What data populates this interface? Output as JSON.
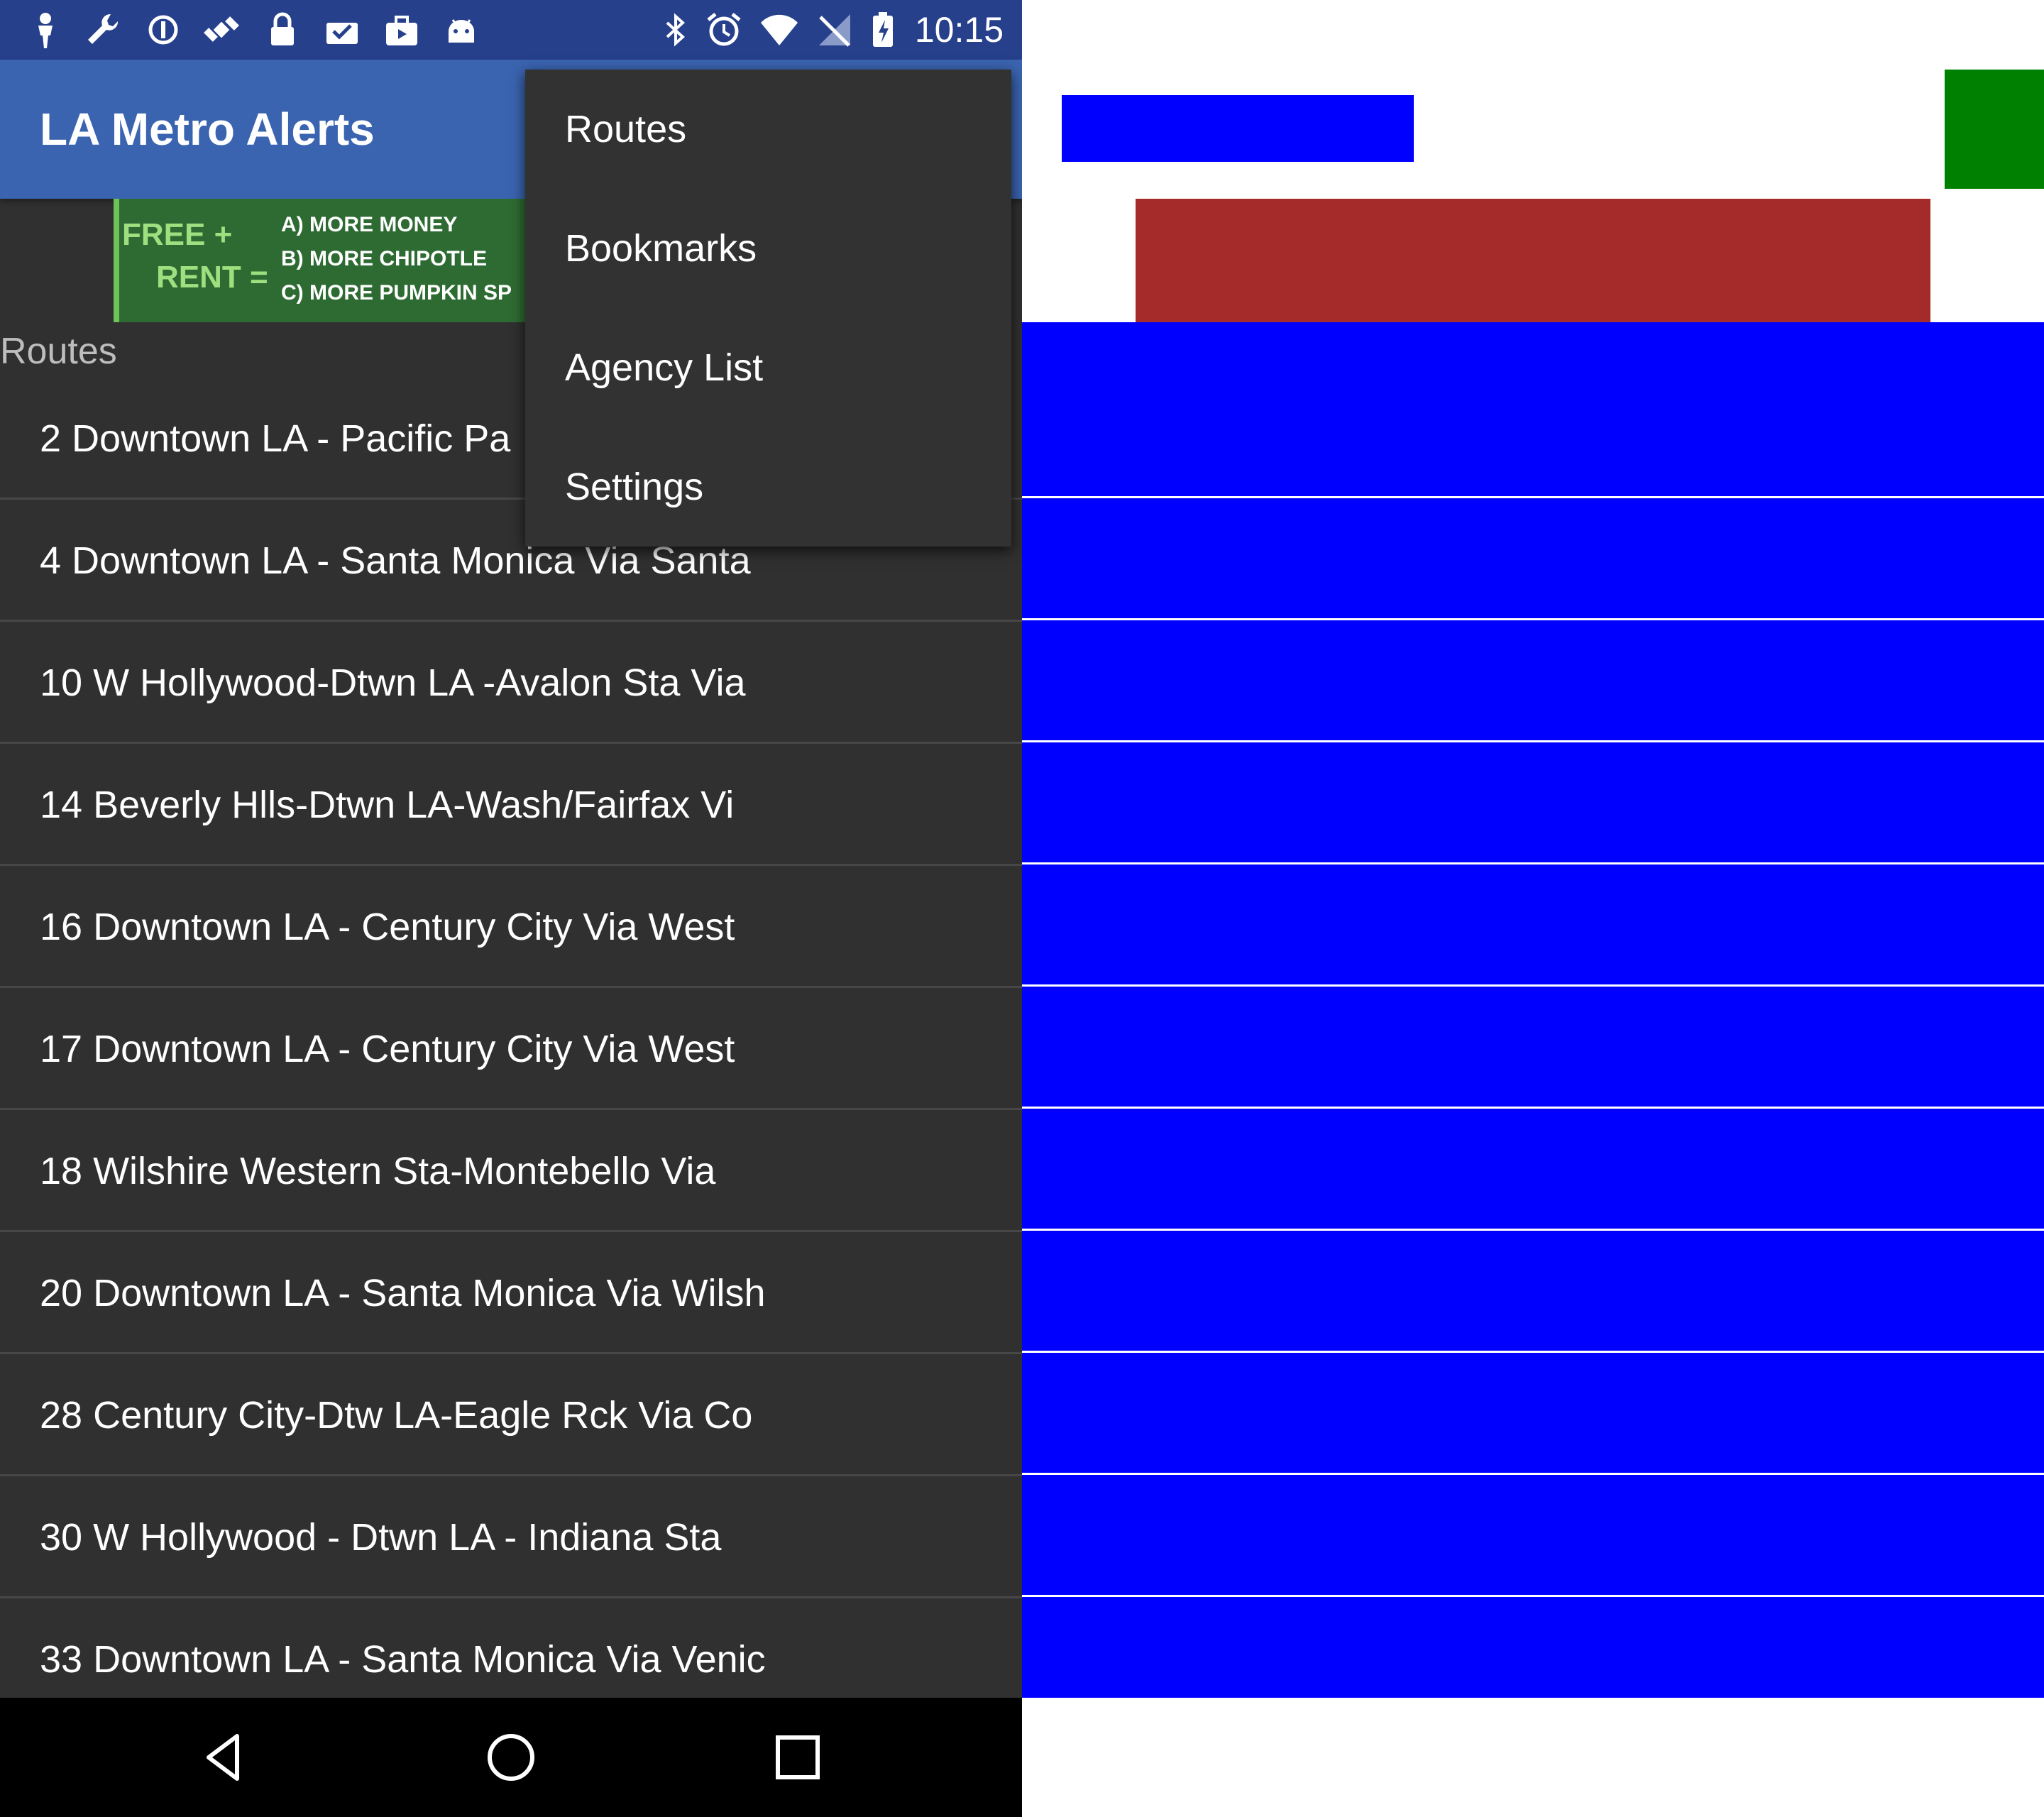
{
  "status_bar": {
    "time": "10:15",
    "left_icons": [
      "person-icon",
      "wrench-icon",
      "data-saver-icon",
      "satellite-icon",
      "lock-icon",
      "mail-check-icon",
      "briefcase-icon",
      "android-icon"
    ],
    "right_icons": [
      "bluetooth-icon",
      "alarm-icon",
      "wifi-icon",
      "no-signal-icon",
      "battery-charging-icon"
    ]
  },
  "app_bar": {
    "title": "LA Metro Alerts"
  },
  "ad": {
    "free": "FREE +",
    "rent": "RENT =",
    "line_a": "A) MORE MONEY",
    "line_b": "B) MORE CHIPOTLE",
    "line_c": "C) MORE PUMPKIN SP"
  },
  "list": {
    "header": "Routes",
    "routes": [
      "2 Downtown LA - Pacific Pa",
      "4 Downtown LA - Santa Monica Via Santa",
      "10 W Hollywood-Dtwn LA -Avalon Sta Via",
      "14 Beverly Hlls-Dtwn LA-Wash/Fairfax Vi",
      "16 Downtown LA - Century City Via West",
      "17 Downtown LA - Century City Via West",
      "18 Wilshire Western Sta-Montebello Via",
      "20 Downtown LA - Santa Monica Via Wilsh",
      "28 Century City-Dtw LA-Eagle Rck Via Co",
      "30 W Hollywood - Dtwn LA - Indiana Sta",
      "33 Downtown LA - Santa Monica Via Venic"
    ]
  },
  "menu": {
    "items": [
      "Routes",
      "Bookmarks",
      "Agency List",
      "Settings"
    ]
  },
  "nav_bar": {
    "icons": [
      "back-icon",
      "home-icon",
      "recents-icon"
    ]
  },
  "colors": {
    "status_bar": "#27408c",
    "app_bar": "#3a64b0",
    "list_background": "#303030",
    "menu_background": "#323232",
    "overlay_blue": "#0000ff",
    "overlay_green": "#008000",
    "overlay_brown": "#a52a2a"
  }
}
